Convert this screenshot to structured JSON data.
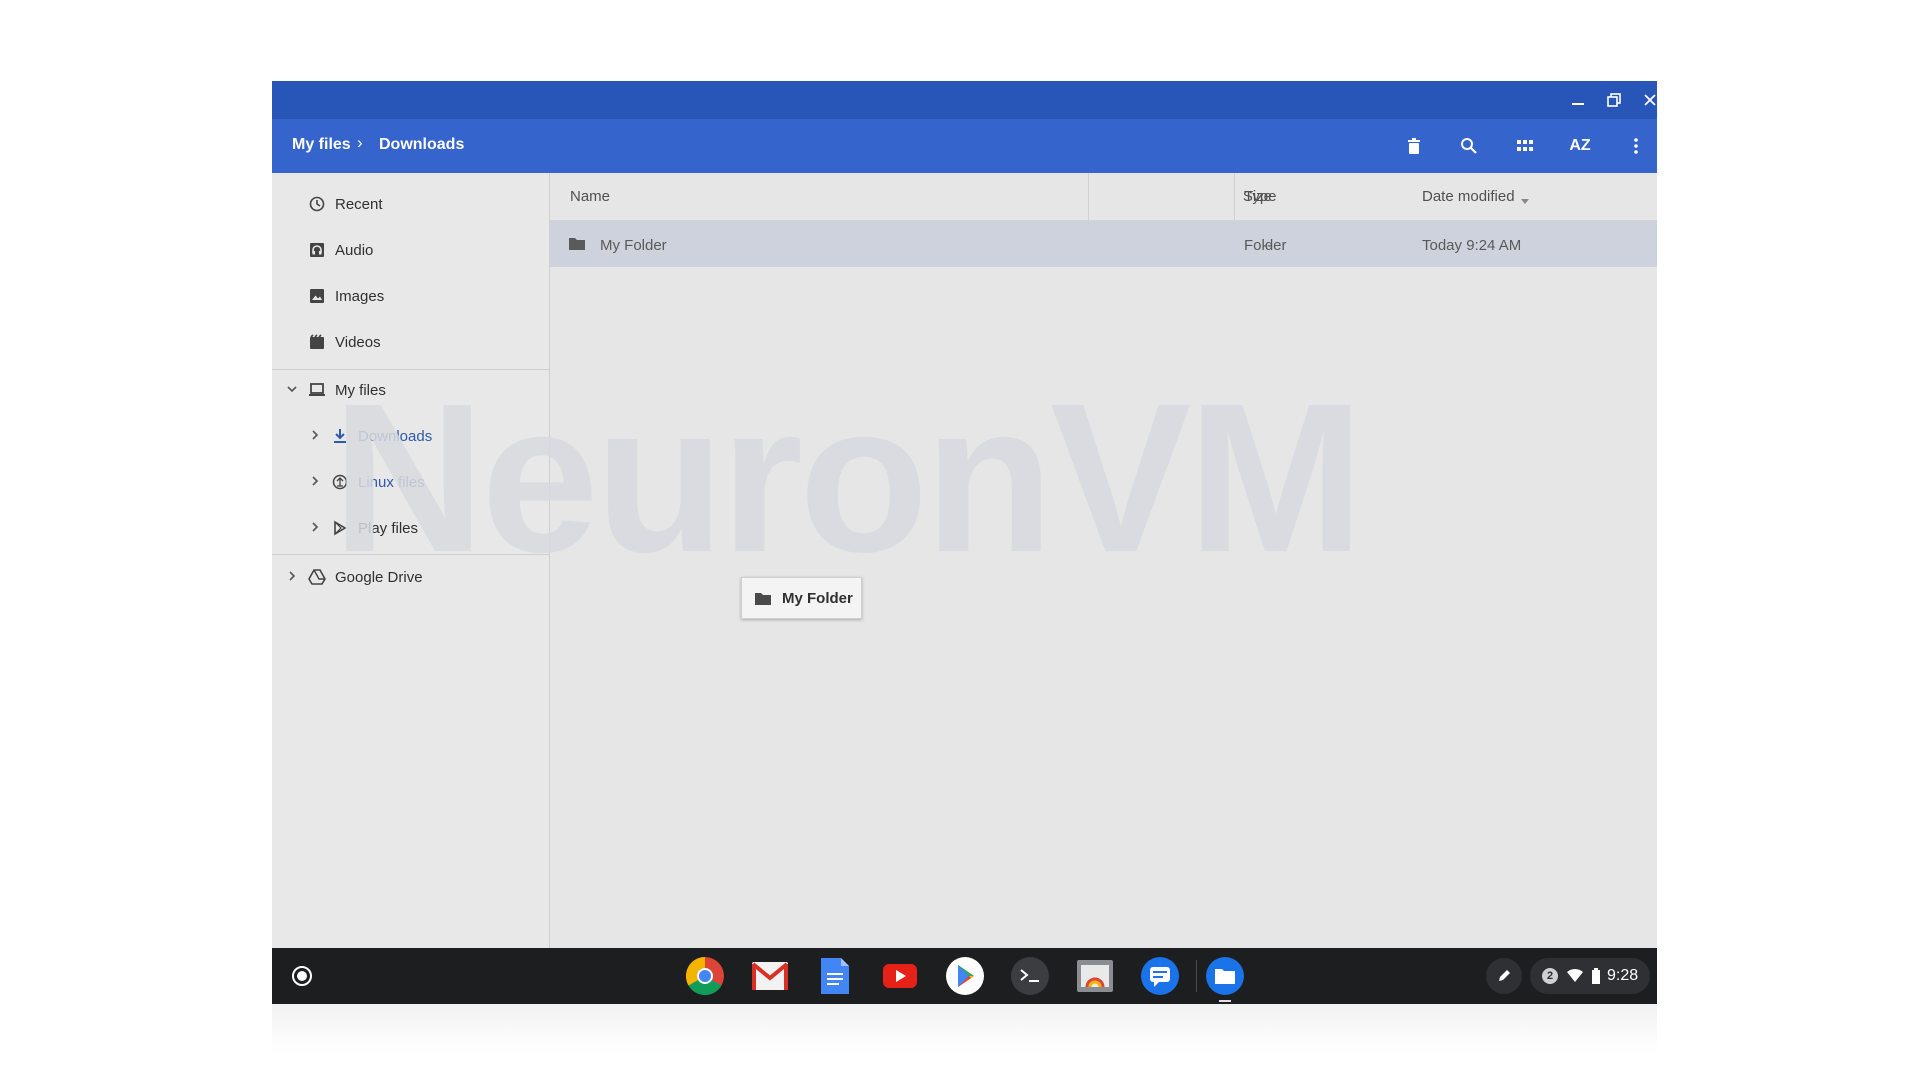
{
  "window": {
    "controls": {
      "minimize": "minimize-icon",
      "maximize": "restore-icon",
      "close": "close-icon"
    }
  },
  "toolbar": {
    "breadcrumb": [
      "My files",
      "Downloads"
    ],
    "actions": [
      "delete-icon",
      "search-icon",
      "grid-view-icon",
      "sort-az-icon",
      "more-vert-icon"
    ],
    "sort_label": "AZ"
  },
  "sidebar": {
    "recents": [
      {
        "label": "Recent",
        "icon": "clock-icon"
      },
      {
        "label": "Audio",
        "icon": "audio-icon"
      },
      {
        "label": "Images",
        "icon": "image-icon"
      },
      {
        "label": "Videos",
        "icon": "video-icon"
      }
    ],
    "my_files": {
      "label": "My files",
      "icon": "laptop-icon"
    },
    "children": [
      {
        "label": "Downloads",
        "icon": "download-icon"
      },
      {
        "label": "Linux files",
        "icon": "linux-icon"
      },
      {
        "label": "Play files",
        "icon": "play-icon"
      }
    ],
    "drive": {
      "label": "Google Drive",
      "icon": "drive-icon"
    }
  },
  "file_list": {
    "columns": {
      "name": "Name",
      "size": "Size",
      "type": "Type",
      "date": "Date modified"
    },
    "rows": [
      {
        "name": "My Folder",
        "size": "--",
        "type": "Folder",
        "date": "Today 9:24 AM"
      }
    ]
  },
  "drag_chip": {
    "label": "My Folder"
  },
  "watermark": "NeuronVM",
  "shelf": {
    "launcher_icon": "launcher-icon",
    "apps": [
      "chrome-icon",
      "gmail-icon",
      "docs-icon",
      "youtube-icon",
      "play-store-icon",
      "terminal-icon",
      "gallery-icon",
      "messages-icon",
      "files-icon"
    ],
    "status": {
      "notifications": "2",
      "time": "9:28"
    }
  }
}
